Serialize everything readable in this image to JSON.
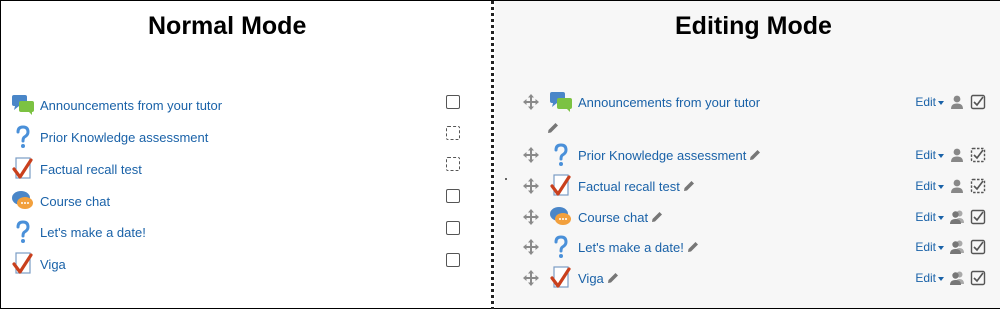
{
  "normal_mode": {
    "title": "Normal Mode",
    "activities": [
      {
        "label": "Announcements from your tutor",
        "icon": "forum-icon",
        "completion": "manual"
      },
      {
        "label": "Prior Knowledge assessment",
        "icon": "question-icon",
        "completion": "auto"
      },
      {
        "label": "Factual recall test",
        "icon": "quiz-icon",
        "completion": "auto"
      },
      {
        "label": "Course chat",
        "icon": "chat-icon",
        "completion": "manual"
      },
      {
        "label": "Let's make a date!",
        "icon": "question-icon",
        "completion": "manual"
      },
      {
        "label": "Viga",
        "icon": "quiz-icon",
        "completion": "manual"
      }
    ]
  },
  "editing_mode": {
    "title": "Editing Mode",
    "edit_label": "Edit",
    "activities": [
      {
        "label": "Announcements from your tutor",
        "icon": "forum-icon",
        "role_icon": "person-icon",
        "completion": "manual"
      },
      {
        "label": "Prior Knowledge assessment",
        "icon": "question-icon",
        "role_icon": "person-icon",
        "completion": "auto"
      },
      {
        "label": "Factual recall test",
        "icon": "quiz-icon",
        "role_icon": "person-icon",
        "completion": "auto"
      },
      {
        "label": "Course chat",
        "icon": "chat-icon",
        "role_icon": "group-icon",
        "completion": "manual"
      },
      {
        "label": "Let's make a date!",
        "icon": "question-icon",
        "role_icon": "group-icon",
        "completion": "manual"
      },
      {
        "label": "Viga",
        "icon": "quiz-icon",
        "role_icon": "group-icon",
        "completion": "manual"
      }
    ]
  },
  "colors": {
    "link": "#1a62a8",
    "editing_background": "#f7f7f7",
    "divider": "#222222"
  }
}
